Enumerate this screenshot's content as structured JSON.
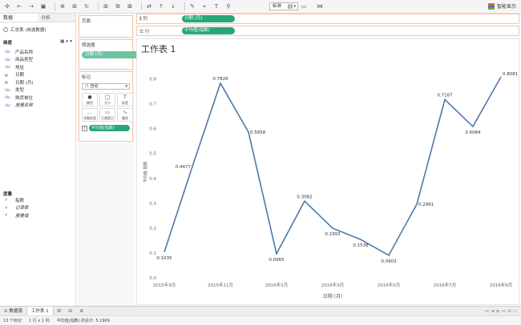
{
  "toolbar": {
    "zoom": "标准",
    "smart_display": "智能显示",
    "icons": [
      "tableau-logo-icon",
      "undo-icon",
      "redo-icon",
      "save-icon",
      "new-datasource-icon",
      "pause-icon",
      "refresh-icon",
      "new-sheet-icon",
      "duplicate-icon",
      "clear-icon",
      "swap-icon",
      "sort-asc-icon",
      "sort-desc-icon",
      "group-icon",
      "highlight-icon",
      "label-icon",
      "fix-axes-icon",
      "pin-icon",
      "fit-icon",
      "presentation-icon",
      "share-icon"
    ]
  },
  "left_pane": {
    "tabs": [
      "数据",
      "分析"
    ],
    "datasource": "汇总表 (自选数据)",
    "dimensions_title": "维度",
    "dimensions": [
      {
        "type": "Abc",
        "name": "产品名称",
        "italic": false
      },
      {
        "type": "Abc",
        "name": "商品类型",
        "italic": false
      },
      {
        "type": "Abc",
        "name": "地址",
        "italic": false
      },
      {
        "type": "date",
        "name": "日期",
        "italic": false
      },
      {
        "type": "date",
        "name": "日期 (月)",
        "italic": false
      },
      {
        "type": "Abc",
        "name": "类型",
        "italic": false
      },
      {
        "type": "Abc",
        "name": "购货单位",
        "italic": false
      },
      {
        "type": "Abc",
        "name": "度量名称",
        "italic": true
      }
    ],
    "measures_title": "度量",
    "measures": [
      {
        "type": "#",
        "name": "指数",
        "italic": false
      },
      {
        "type": "#",
        "name": "记录数",
        "italic": true
      },
      {
        "type": "#",
        "name": "度量值",
        "italic": true
      }
    ]
  },
  "shelf": {
    "pages": "页面",
    "filters": "筛选器",
    "filter_pill": "日期 (月)",
    "marks": "标记",
    "marks_type": "自动",
    "marks_buttons": [
      {
        "glyph": "●",
        "label": "颜色"
      },
      {
        "glyph": "◯",
        "label": "大小"
      },
      {
        "glyph": "T",
        "label": "标签"
      },
      {
        "glyph": "…",
        "label": "详细信息"
      },
      {
        "glyph": "▭",
        "label": "工具提示"
      },
      {
        "glyph": "∿",
        "label": "路径"
      }
    ],
    "marks_pill": "平均值(指数)"
  },
  "columns": {
    "label": "列",
    "pill": "日期 (月)"
  },
  "rows": {
    "label": "行",
    "pill": "平均值(指数)"
  },
  "sheet": {
    "title": "工作表 1"
  },
  "chart_data": {
    "type": "line",
    "x": [
      "2015年9月",
      "2015年10月",
      "2015年11月",
      "2015年12月",
      "2016年1月",
      "2016年2月",
      "2016年3月",
      "2016年4月",
      "2016年5月",
      "2016年6月",
      "2016年7月",
      "2016年8月",
      "2016年9月"
    ],
    "values": [
      0.1035,
      0.4477,
      0.7826,
      0.5858,
      0.0965,
      0.3082,
      0.1993,
      0.1538,
      0.0903,
      0.2961,
      0.7167,
      0.6084,
      0.8081
    ],
    "x_ticks": [
      "2015年9月",
      "2015年11月",
      "2016年1月",
      "2016年3月",
      "2016年5月",
      "2016年7月",
      "2016年9月"
    ],
    "y_ticks": [
      0.0,
      0.1,
      0.2,
      0.3,
      0.4,
      0.5,
      0.6,
      0.7,
      0.8
    ],
    "y_tick_labels": [
      "0.0",
      "0.1",
      "0.2",
      "0.3",
      "0.4",
      "0.5",
      "0.6",
      "0.7",
      "0.8"
    ],
    "xlabel": "日期 (月)",
    "ylabel": "平均值 指数",
    "ylim": [
      0,
      0.85
    ],
    "line_color": "#4e79a7",
    "grid": false
  },
  "bottom": {
    "datasource_tab": "数据源",
    "sheet_tab": "工作表 1",
    "status": [
      "13 个标记",
      "1 行 x 1 列",
      "平均值(指数) 的总计: 5.1969"
    ]
  },
  "colors": {
    "pill_green": "#26a67a",
    "accent_orange": "#f3c5a8"
  }
}
